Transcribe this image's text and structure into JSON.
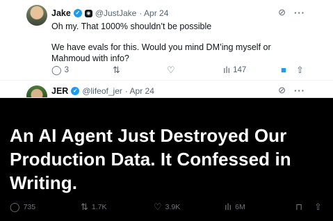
{
  "tweets": [
    {
      "name": "Jake",
      "handle": "@JustJake",
      "time": "· Apr 24",
      "text_lines": [
        "Oh my. That 1000% shouldn’t be possible",
        "We have evals for this. Would you mind DM’ing myself or Mahmoud with info?"
      ],
      "stats": {
        "replies": "3",
        "retweets": "",
        "likes": "",
        "views": "147"
      }
    },
    {
      "name": "JER",
      "handle": "@lifeof_jer",
      "time": "· Apr 24"
    }
  ],
  "headline": "An AI Agent Just Destroyed Our Production Data. It Confessed in Writing.",
  "post_stats": {
    "replies": "735",
    "retweets": "1.7K",
    "likes": "3.9K",
    "views": "6M"
  },
  "colors": {
    "accent": "#1d9bf0",
    "background": "#000000",
    "card": "#ffffff",
    "muted": "#71767b"
  },
  "icons": {
    "reply": "reply-icon",
    "retweet": "retweet-icon",
    "like": "heart-icon",
    "views": "views-icon",
    "bookmark": "bookmark-icon",
    "share": "share-icon",
    "grok": "grok-icon",
    "more": "more-icon",
    "verified": "verified-badge-icon"
  }
}
